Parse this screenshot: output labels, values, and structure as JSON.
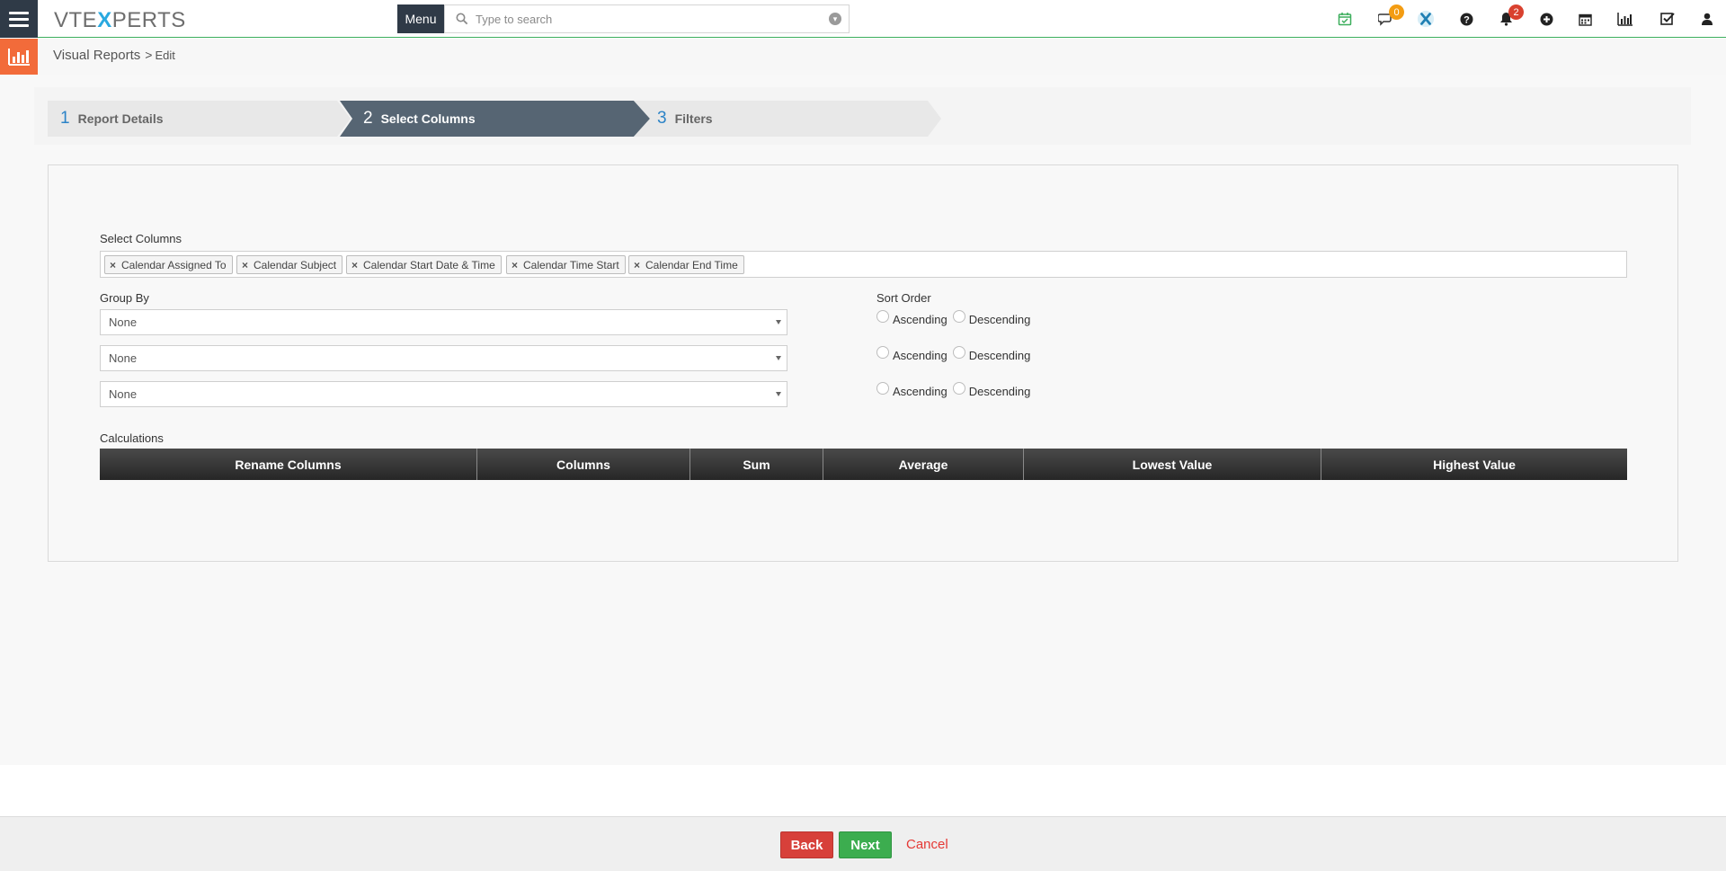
{
  "header": {
    "logo_prefix": "VTE",
    "logo_x": "X",
    "logo_suffix": "PERTS",
    "menu_label": "Menu",
    "search_placeholder": "Type to search",
    "chat_badge": "0",
    "notification_badge": "2"
  },
  "breadcrumb": {
    "module": "Visual Reports",
    "separator": ">",
    "page": "Edit"
  },
  "wizard": {
    "steps": [
      {
        "num": "1",
        "label": "Report Details"
      },
      {
        "num": "2",
        "label": "Select Columns"
      },
      {
        "num": "3",
        "label": "Filters"
      }
    ]
  },
  "form": {
    "select_columns_label": "Select Columns",
    "selected_columns": [
      "Calendar Assigned To",
      "Calendar Subject",
      "Calendar Start Date & Time",
      "Calendar Time Start",
      "Calendar End Time"
    ],
    "group_by_label": "Group By",
    "group_by_values": [
      "None",
      "None",
      "None"
    ],
    "sort_order_label": "Sort Order",
    "ascending_label": "Ascending",
    "descending_label": "Descending",
    "calculations_label": "Calculations",
    "calc_headers": [
      "Rename Columns",
      "Columns",
      "Sum",
      "Average",
      "Lowest Value",
      "Highest Value"
    ]
  },
  "footer": {
    "back_label": "Back",
    "next_label": "Next",
    "cancel_label": "Cancel"
  },
  "colors": {
    "nav_dark": "#2f3a47",
    "accent_orange": "#f26b3a",
    "step_active": "#566573",
    "back_red": "#d7403a",
    "next_green": "#3cad4f"
  }
}
